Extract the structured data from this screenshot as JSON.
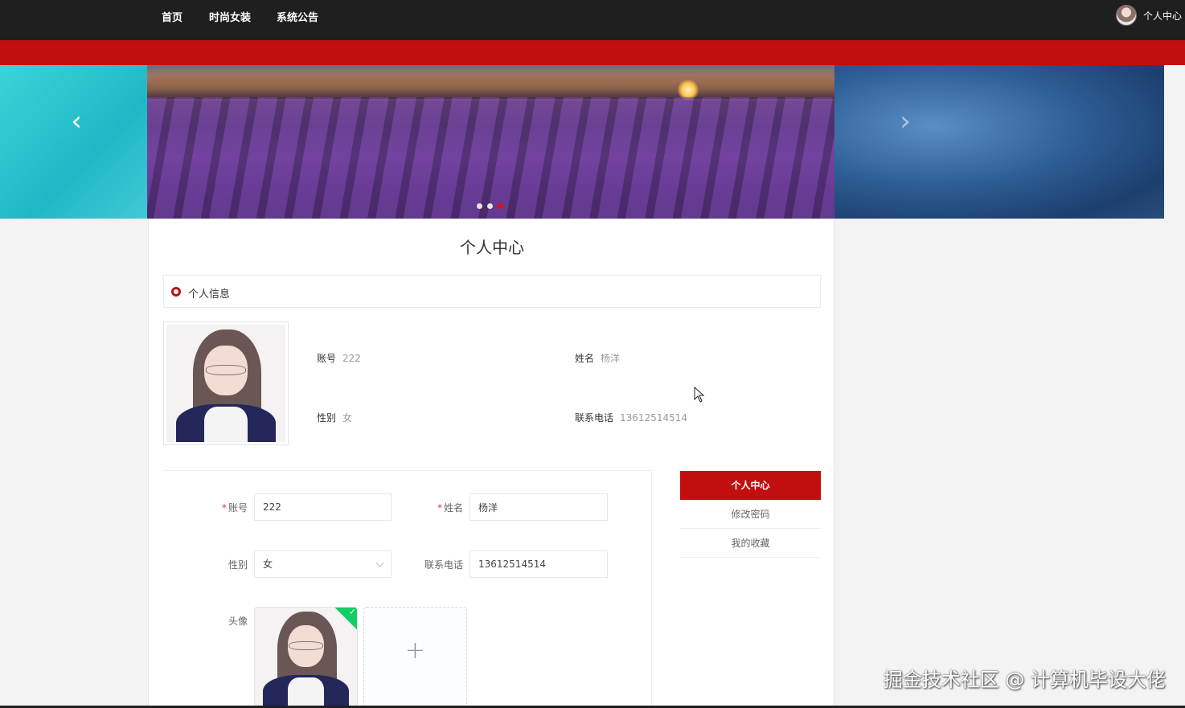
{
  "nav": {
    "items": [
      "首页",
      "时尚女装",
      "系统公告"
    ],
    "user_label": "个人中心"
  },
  "banner": {
    "prev_glyph": "‹",
    "next_glyph": "›",
    "slide_count": 3,
    "active_index": 2
  },
  "page": {
    "title": "个人中心",
    "section_label": "个人信息"
  },
  "profile": {
    "account_label": "账号",
    "account_value": "222",
    "name_label": "姓名",
    "name_value": "杨洋",
    "gender_label": "性别",
    "gender_value": "女",
    "phone_label": "联系电话",
    "phone_value": "13612514514"
  },
  "form": {
    "required_mark": "*",
    "account_label": "账号",
    "account_value": "222",
    "name_label": "姓名",
    "name_value": "杨洋",
    "gender_label": "性别",
    "gender_value": "女",
    "phone_label": "联系电话",
    "phone_value": "13612514514",
    "avatar_label": "头像",
    "upload_add_glyph": "+",
    "upload_done_glyph": "✓"
  },
  "side_menu": {
    "items": [
      "个人中心",
      "修改密码",
      "我的收藏"
    ],
    "active_index": 0
  },
  "watermark": "掘金技术社区 @ 计算机毕设大佬",
  "colors": {
    "brand_red": "#c20e0e",
    "nav_bg": "#1f1f1f",
    "success_green": "#13ce66"
  }
}
